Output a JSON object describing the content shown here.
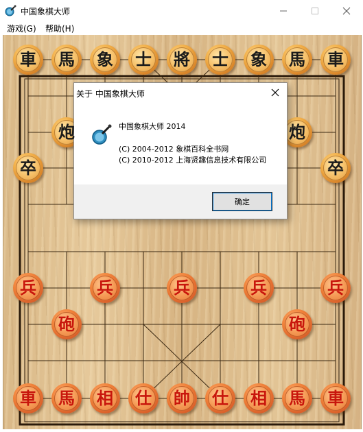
{
  "window": {
    "title": "中国象棋大师",
    "icon": "chess-app-icon",
    "controls": {
      "minimize": "minimize-icon",
      "maximize": "maximize-icon",
      "close": "close-icon"
    }
  },
  "menu": [
    {
      "label": "游戏(G)"
    },
    {
      "label": "帮助(H)"
    }
  ],
  "board": {
    "river_text": "",
    "pieces": {
      "black_back_rank": [
        "車",
        "馬",
        "象",
        "士",
        "將",
        "士",
        "象",
        "馬",
        "車"
      ],
      "black_cannons": [
        "炮",
        "炮"
      ],
      "black_pawns": [
        "卒",
        "卒"
      ],
      "red_pawns": [
        "兵",
        "兵",
        "兵",
        "兵",
        "兵"
      ],
      "red_cannons": [
        "砲",
        "砲"
      ],
      "red_back_rank": [
        "車",
        "馬",
        "相",
        "仕",
        "帥",
        "仕",
        "相",
        "馬",
        "車"
      ]
    },
    "colors": {
      "black_text": "#1a1a1a",
      "red_text": "#c8160c",
      "line": "#2a1a0a"
    }
  },
  "about_dialog": {
    "title": "关于 中国象棋大师",
    "product": "中国象棋大师 2014",
    "copyright_1": "(C) 2004-2012 象棋百科全书网",
    "copyright_2": "(C) 2010-2012 上海贤趣信息技术有限公司",
    "ok_label": "确定",
    "icon": "chess-app-icon"
  }
}
